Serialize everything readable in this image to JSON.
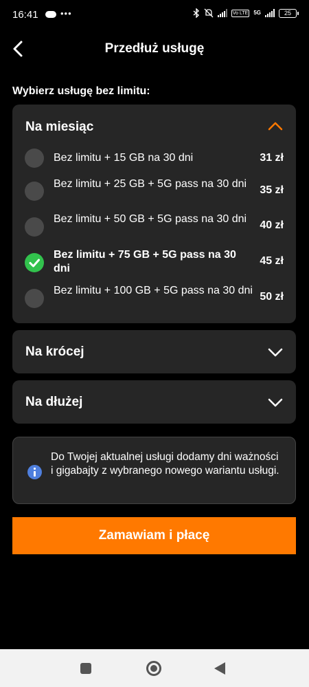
{
  "status_bar": {
    "time": "16:41",
    "dots": "•••",
    "volte_tag": "Vo LTE",
    "network": "5G",
    "battery": "25"
  },
  "header": {
    "title": "Przedłuż usługę",
    "back_icon": "chevron-left-icon"
  },
  "section_label": "Wybierz usługę bez limitu:",
  "accordion": {
    "monthly": {
      "title": "Na miesiąc",
      "expanded": true,
      "options": [
        {
          "label": "Bez limitu + 15 GB na 30 dni",
          "price": "31 zł",
          "selected": false
        },
        {
          "label": "Bez limitu + 25 GB + 5G pass na 30 dni",
          "price": "35 zł",
          "selected": false
        },
        {
          "label": "Bez limitu + 50 GB + 5G pass na 30 dni",
          "price": "40 zł",
          "selected": false
        },
        {
          "label": "Bez limitu + 75 GB + 5G pass na 30 dni",
          "price": "45 zł",
          "selected": true
        },
        {
          "label": "Bez limitu + 100 GB + 5G pass na 30 dni",
          "price": "50 zł",
          "selected": false
        }
      ]
    },
    "shorter": {
      "title": "Na krócej",
      "expanded": false
    },
    "longer": {
      "title": "Na dłużej",
      "expanded": false
    }
  },
  "info": {
    "text": "Do Twojej aktualnej usługi dodamy dni ważności i gigabajty z wybranego nowego wariantu usługi."
  },
  "cta_label": "Zamawiam i płacę",
  "colors": {
    "accent": "#ff7900",
    "selected": "#32c24d",
    "panel": "#262626",
    "info_icon": "#4f7fdd"
  }
}
